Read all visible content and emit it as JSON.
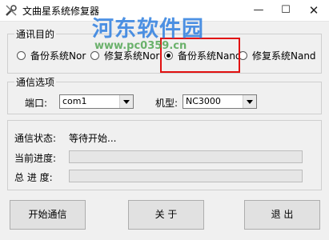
{
  "window": {
    "title": "文曲星系统修复器",
    "minimize": "—",
    "maximize": "☐",
    "close": "✕"
  },
  "watermark": {
    "text": "河东软件园",
    "url": "www.pc0359.cn"
  },
  "mode_group": {
    "legend": "通讯目的",
    "options": [
      {
        "label": "备份系统Nor",
        "selected": false
      },
      {
        "label": "修复系统Nor",
        "selected": false
      },
      {
        "label": "备份系统Nand",
        "selected": true
      },
      {
        "label": "修复系统Nand",
        "selected": false
      }
    ],
    "highlight_color": "#e11111"
  },
  "comm_group": {
    "legend": "通信选项",
    "port_label": "端口:",
    "port_value": "com1",
    "model_label": "机型:",
    "model_value": "NC3000"
  },
  "status_group": {
    "status_label": "通信状态:",
    "status_value": "等待开始...",
    "current_label": "当前进度:",
    "current_progress": 0,
    "total_label": "总 进 度:",
    "total_progress": 0
  },
  "buttons": {
    "start": "开始通信",
    "about": "关  于",
    "exit": "退  出"
  }
}
